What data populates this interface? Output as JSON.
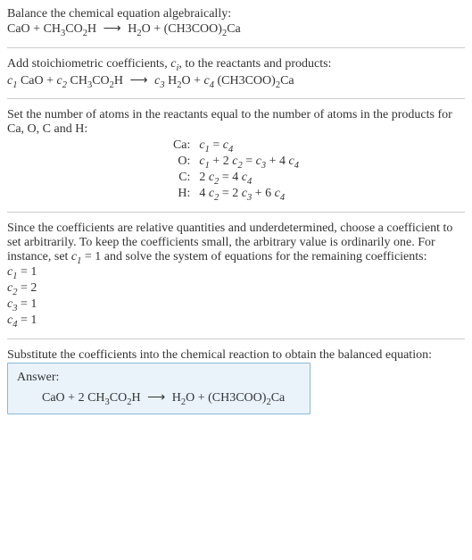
{
  "intro": {
    "line1": "Balance the chemical equation algebraically:"
  },
  "step_coeff": {
    "line1_a": "Add stoichiometric coefficients, ",
    "line1_b": ", to the reactants and products:"
  },
  "step_atoms": {
    "line1": "Set the number of atoms in the reactants equal to the number of atoms in the products for Ca, O, C and H:",
    "rows": [
      {
        "el": "Ca:",
        "eq_id": "eq-ca"
      },
      {
        "el": "O:",
        "eq_id": "eq-o"
      },
      {
        "el": "C:",
        "eq_id": "eq-c"
      },
      {
        "el": "H:",
        "eq_id": "eq-h"
      }
    ]
  },
  "step_solve": {
    "para_a": "Since the coefficients are relative quantities and underdetermined, choose a coefficient to set arbitrarily. To keep the coefficients small, the arbitrary value is ordinarily one. For instance, set ",
    "para_b": " = 1 and solve the system of equations for the remaining coefficients:"
  },
  "step_substitute": {
    "line1": "Substitute the coefficients into the chemical reaction to obtain the balanced equation:"
  },
  "answer": {
    "title": "Answer:"
  },
  "chem": {
    "CaO": "CaO",
    "plus": " + ",
    "CH3CO2H_a": "CH",
    "CH3CO2H_b": "3",
    "CH3CO2H_c": "CO",
    "CH3CO2H_d": "2",
    "CH3CO2H_e": "H",
    "arrow": "⟶",
    "H2O_a": "H",
    "H2O_b": "2",
    "H2O_c": "O",
    "CH3COO2Ca_a": "(CH3COO)",
    "CH3COO2Ca_b": "2",
    "CH3COO2Ca_c": "Ca",
    "two": "2 ",
    "c1": "c",
    "c2": "c",
    "c3": "c",
    "c4": "c",
    "s1": "1",
    "s2": "2",
    "s3": "3",
    "s4": "4",
    "ci": "c",
    "si": "i",
    "sp": " "
  },
  "atom_eq": {
    "ca_a": " = ",
    "o_a": " + 2 ",
    "o_b": " = ",
    "o_c": " + 4 ",
    "c_a": "2 ",
    "c_b": " = 4 ",
    "h_a": "4 ",
    "h_b": " = 2 ",
    "h_c": " + 6 "
  },
  "solve_vals": {
    "eq1": " = 1",
    "eq2": " = 2",
    "eq3": " = 1",
    "eq4": " = 1"
  }
}
